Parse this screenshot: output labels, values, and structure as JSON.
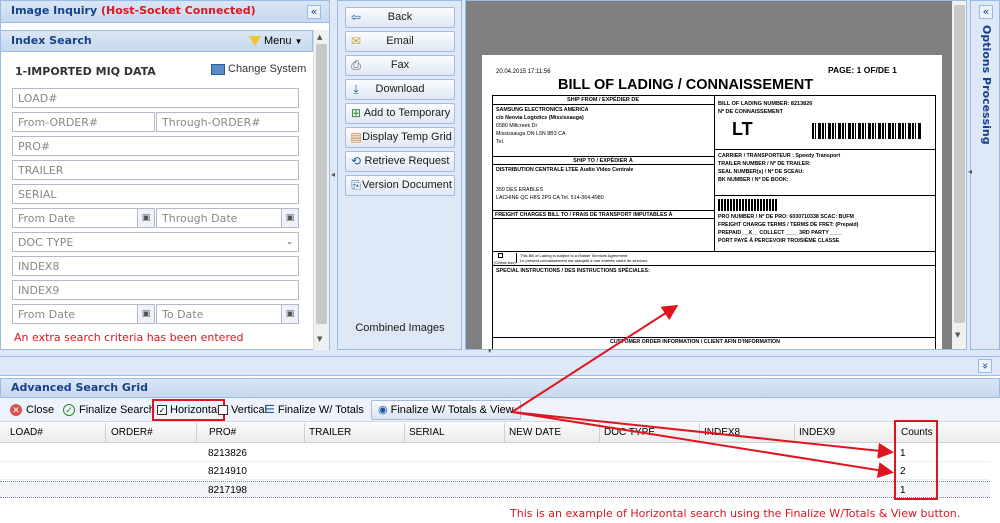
{
  "left_panel": {
    "title_prefix": "Image Inquiry ",
    "title_status": "(Host-Socket Connected)",
    "collapse_glyph": "«",
    "section_title": "Index Search",
    "menu_label": "Menu",
    "system_label": "1-IMPORTED MIQ DATA",
    "change_system_label": "Change System",
    "fields": {
      "load": "LOAD#",
      "from_order": "From-ORDER#",
      "through_order": "Through-ORDER#",
      "pro": "PRO#",
      "trailer": "TRAILER",
      "serial": "SERIAL",
      "from_date": "From Date",
      "through_date": "Through Date",
      "doc_type": "DOC TYPE",
      "index8": "INDEX8",
      "index9": "INDEX9",
      "from_date2": "From Date",
      "to_date": "To Date"
    },
    "warning": "An extra search criteria has been entered"
  },
  "nav_buttons": {
    "back": "Back",
    "email": "Email",
    "fax": "Fax",
    "download": "Download",
    "add_temp": "Add to Temporary",
    "display_temp": "Display Temp Grid",
    "retrieve": "Retrieve Request",
    "version": "Version Document",
    "combined": "Combined Images"
  },
  "options_panel": {
    "collapse_glyph": "«",
    "title": "Options Processing"
  },
  "document": {
    "date": "20.04.2015  17:11:56",
    "page": "PAGE: 1 OF/DE  1",
    "title": "BILL OF LADING / CONNAISSEMENT",
    "ship_from_hdr": "SHIP FROM  /  EXPÉDIER DE",
    "ship_from_lines": [
      "SAMSUNG ELECTRONICS AMERICA",
      "c/o Neovia Logistics (Mississauga)",
      "6580 Millcreek Dr",
      "Mississauga ON L5N 8B3  CA",
      "Tel."
    ],
    "bol_number": "BILL OF LADING NUMBER: 8213826",
    "bol_fr": "Nº  DE CONNAISSEMENT",
    "lt": "LT",
    "ship_to_hdr": "SHIP TO  /  EXPÉDIER À",
    "ship_to_lines": [
      "DISTRIBUTION CENTRALE LTEE Audio Video Centrale",
      "",
      "350 DES ERABLES",
      "LACHINE  QC H8S 2P9 CA          Tel.  514-364-4980"
    ],
    "carrier": "CARRIER / TRANSPORTEUR :  Speedy Transport",
    "trailer": "TRAILER NUMBER / Nº DE TRAILER:",
    "seal": "SEAL NUMBER(s) / Nº DE SCEAU:",
    "bk": "BK NUMBER / Nº DE BOOK:",
    "freight_hdr": "FREIGHT CHARGES BILL TO  /  FRAIS DE TRANSPORT IMPUTABLES À",
    "pro": "PRO NUMBER / Nº DE PRO:  6030710338   SCAC:  BUFM",
    "terms": "FREIGHT CHARGE TERMS / TERMS DE FRET: (Prepaid)",
    "prepaid": "PREPAID  __X__    COLLECT  ____     3RD PARTY  ____",
    "port": "PORT PAYÉ          À PERCEVOIR      TROISIÈME CLASSE",
    "check_box": "(Check box)",
    "subject1": "This Bill of Lading is subject to a Master Services Agreement.",
    "subject2": "Le présent connaissement est assujetti à une entente cadre de services.",
    "special": "SPECIAL INSTRUCTIONS  /  DES INSTRUCTIONS SPÉCIALES:",
    "customer": "CUSTOMER ORDER INFORMATION / CLIENT AFIN D'INFORMATION"
  },
  "grid": {
    "title": "Advanced Search Grid",
    "expand_glyph": "»",
    "toolbar": {
      "close": "Close",
      "finalize_search": "Finalize Search",
      "horizontal": "Horizontal",
      "vertical": "Vertical",
      "finalize_totals": "Finalize W/ Totals",
      "finalize_totals_view": "Finalize W/ Totals & View"
    },
    "columns": [
      "LOAD#",
      "ORDER#",
      "PRO#",
      "TRAILER",
      "SERIAL",
      "NEW DATE",
      "DOC TYPE",
      "INDEX8",
      "INDEX9",
      "Counts"
    ],
    "rows": [
      {
        "pro": "8213826",
        "count": "1"
      },
      {
        "pro": "8214910",
        "count": "2"
      },
      {
        "pro": "8217198",
        "count": "1"
      }
    ],
    "annotation": "This is an example of Horizontal search using the Finalize W/Totals & View button."
  },
  "colors": {
    "annotation_red": "#e0141e",
    "header_blue": "#15428b"
  }
}
